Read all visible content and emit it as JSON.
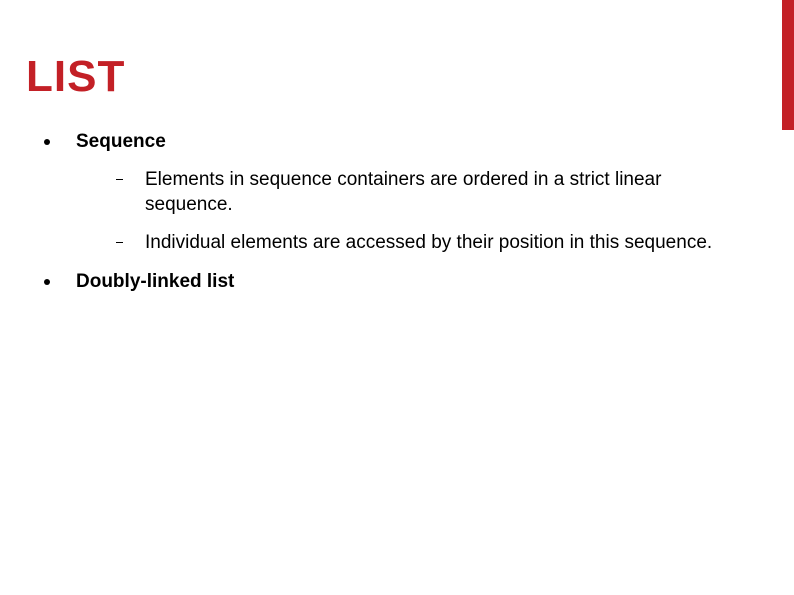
{
  "accent_color": "#c32026",
  "title": "LIST",
  "bullets": [
    {
      "label": "Sequence",
      "children": [
        "Elements in sequence containers are ordered in a strict linear sequence.",
        "Individual elements are accessed by their position in this sequence."
      ]
    },
    {
      "label": "Doubly-linked list",
      "children": []
    }
  ]
}
